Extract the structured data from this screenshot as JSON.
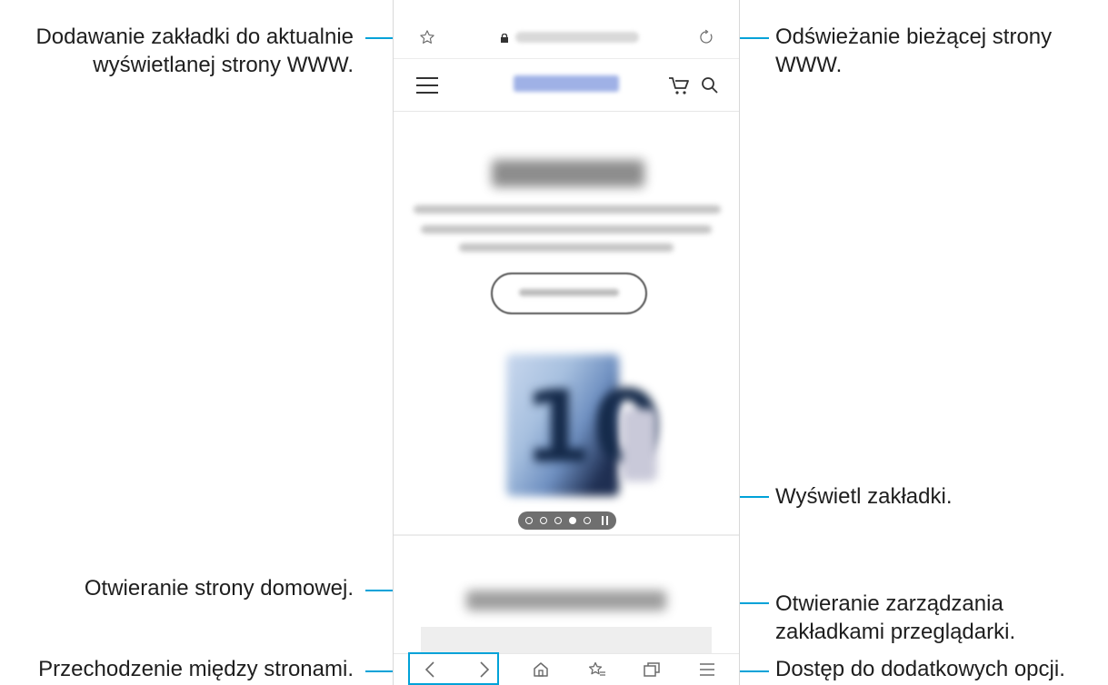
{
  "callouts": {
    "bookmark_add_line1": "Dodawanie zakładki do aktualnie",
    "bookmark_add_line2": "wyświetlanej strony WWW.",
    "refresh_line1": "Odświeżanie bieżącej strony",
    "refresh_line2": "WWW.",
    "view_bookmarks": "Wyświetl zakładki.",
    "home": "Otwieranie strony domowej.",
    "tabs_line1": "Otwieranie zarządzania",
    "tabs_line2": "zakładkami przeglądarki.",
    "navigate": "Przechodzenie między stronami.",
    "more_options": "Dostęp do dodatkowych opcji."
  },
  "colors": {
    "accent_line": "#00a2d8",
    "icon": "#6b6b6b"
  },
  "icons": {
    "bookmark_add": "star-outline-icon",
    "lock": "lock-icon",
    "refresh": "refresh-icon",
    "menu": "hamburger-menu-icon",
    "cart": "cart-icon",
    "search": "search-icon",
    "back": "chevron-left-icon",
    "forward": "chevron-right-icon",
    "home": "home-icon",
    "bookmarks": "bookmarks-list-icon",
    "tabs": "tabs-icon",
    "more": "menu-lines-icon"
  },
  "carousel": {
    "dots": 5,
    "active_index": 3
  }
}
